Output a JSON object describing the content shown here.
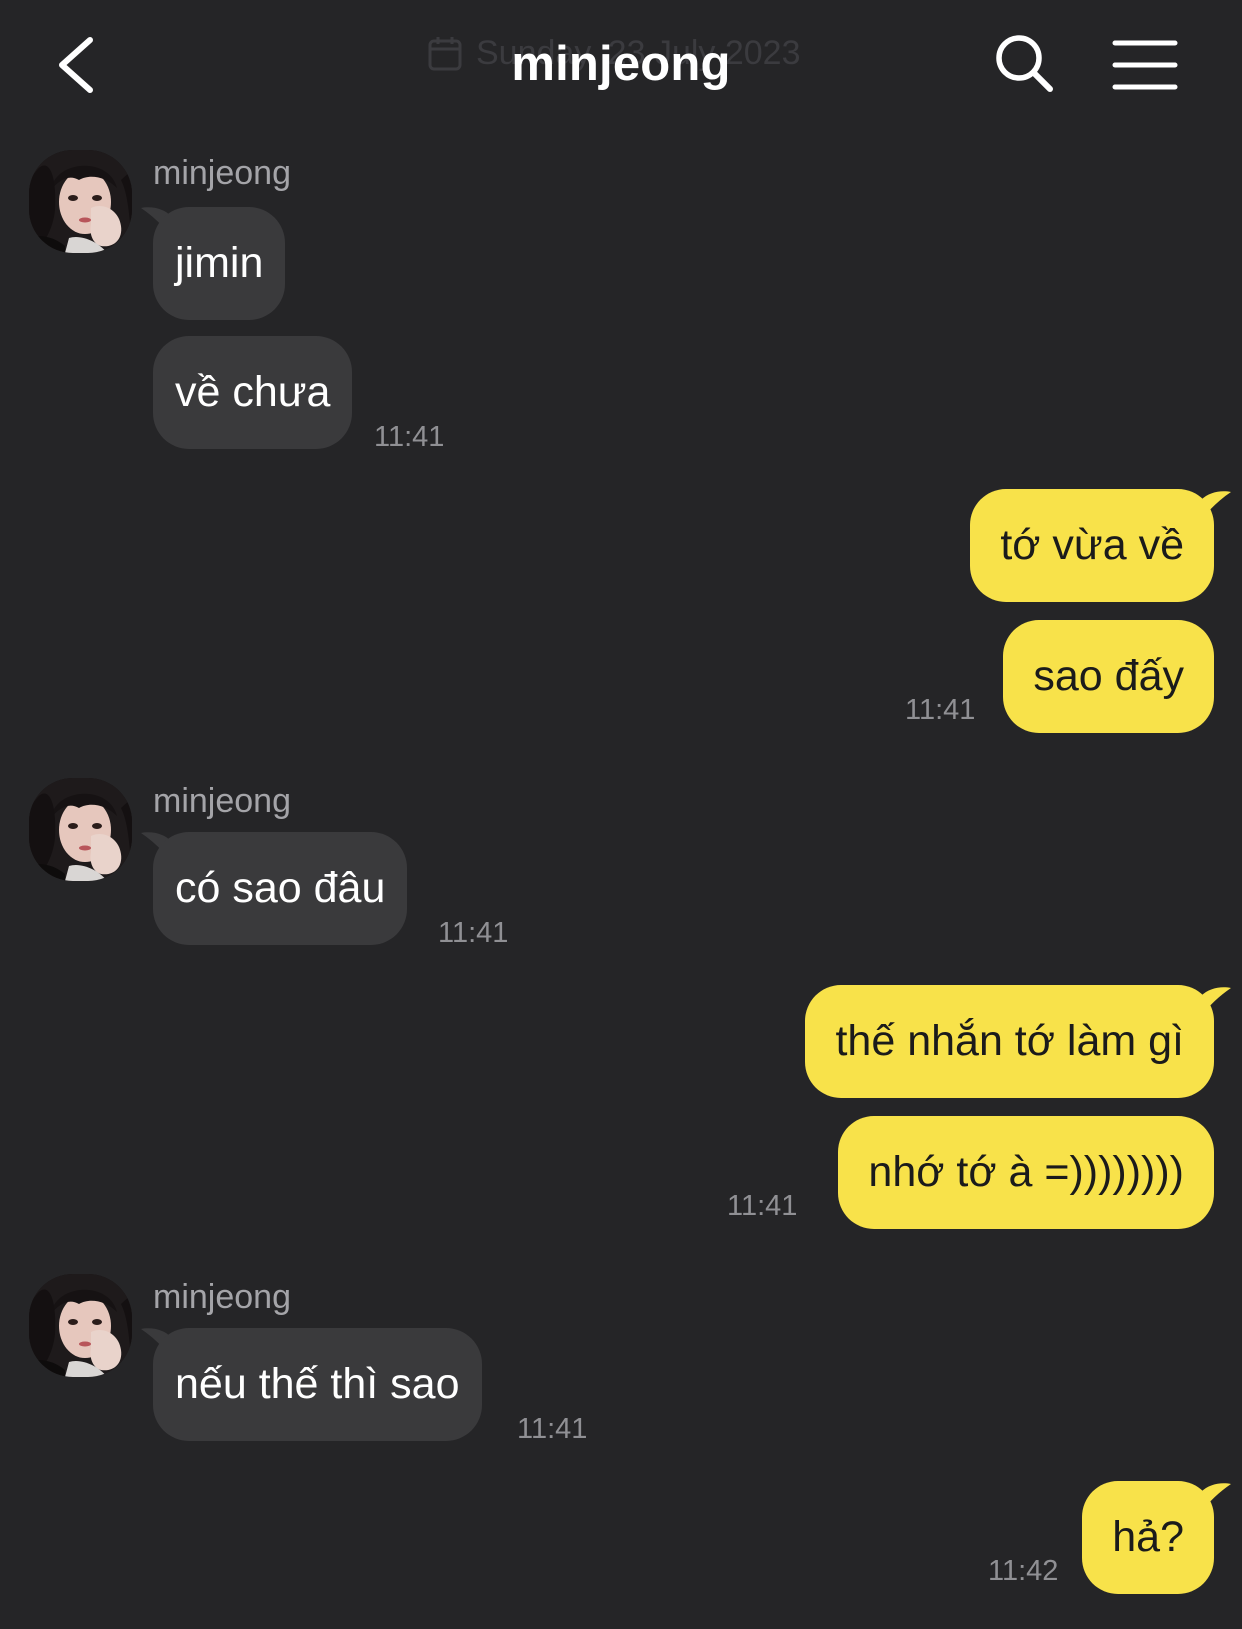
{
  "header": {
    "title": "minjeong",
    "date_divider": "Sunday, 23 July 2023",
    "icons": {
      "back": "chevron-left-icon",
      "search": "search-icon",
      "menu": "hamburger-menu-icon",
      "date": "calendar-icon"
    }
  },
  "colors": {
    "background": "#252527",
    "incoming_bubble": "#3a3a3c",
    "outgoing_bubble": "#f8e24a",
    "sender_name": "#a4a4a8",
    "timestamp": "#909094"
  },
  "messages": [
    {
      "direction": "incoming",
      "sender": "minjeong",
      "bubbles": [
        "jimin",
        "về chưa"
      ],
      "time": "11:41"
    },
    {
      "direction": "outgoing",
      "bubbles": [
        "tớ vừa về",
        "sao đấy"
      ],
      "time": "11:41"
    },
    {
      "direction": "incoming",
      "sender": "minjeong",
      "bubbles": [
        "có sao đâu"
      ],
      "time": "11:41"
    },
    {
      "direction": "outgoing",
      "bubbles": [
        "thế nhắn tớ làm gì",
        "nhớ tớ à =))))))))"
      ],
      "time": "11:41"
    },
    {
      "direction": "incoming",
      "sender": "minjeong",
      "bubbles": [
        "nếu thế thì sao"
      ],
      "time": "11:41"
    },
    {
      "direction": "outgoing",
      "bubbles": [
        "hả?"
      ],
      "time": "11:42"
    }
  ]
}
